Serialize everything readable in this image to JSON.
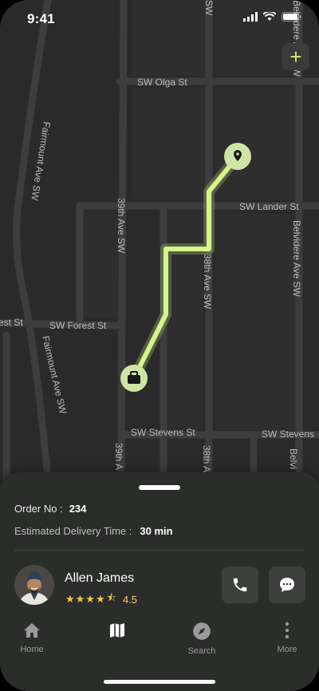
{
  "status_bar": {
    "time": "9:41"
  },
  "map": {
    "streets": [
      "SW Olga St",
      "SW Lander St",
      "SW Forest St",
      "SW Stevens St",
      "SW Stevens",
      "Fairmount Ave SW",
      "Fairmount Ave SW",
      "39th Ave SW",
      "39th A",
      "38th Ave SW",
      "38th A",
      "Belvidere Ave SW",
      "Belvidere Ave SW",
      "Belvi",
      "SW",
      "est St"
    ],
    "route_color": "#d6f58a",
    "pin_color": "#cfe5a6",
    "zoom_label": "+"
  },
  "order": {
    "label": "Order No :",
    "number": "234"
  },
  "delivery": {
    "label": "Estimated Delivery Time :",
    "time": "30 min"
  },
  "driver": {
    "name": "Allen James",
    "stars": "★★★★",
    "half_star": "⯪",
    "rating": "4.5"
  },
  "nav": {
    "home": "Home",
    "map": "",
    "search": "Search",
    "more": "More"
  },
  "colors": {
    "accent": "#d6f58a",
    "sheet": "#2b2d2b",
    "star": "#f2c94c"
  }
}
